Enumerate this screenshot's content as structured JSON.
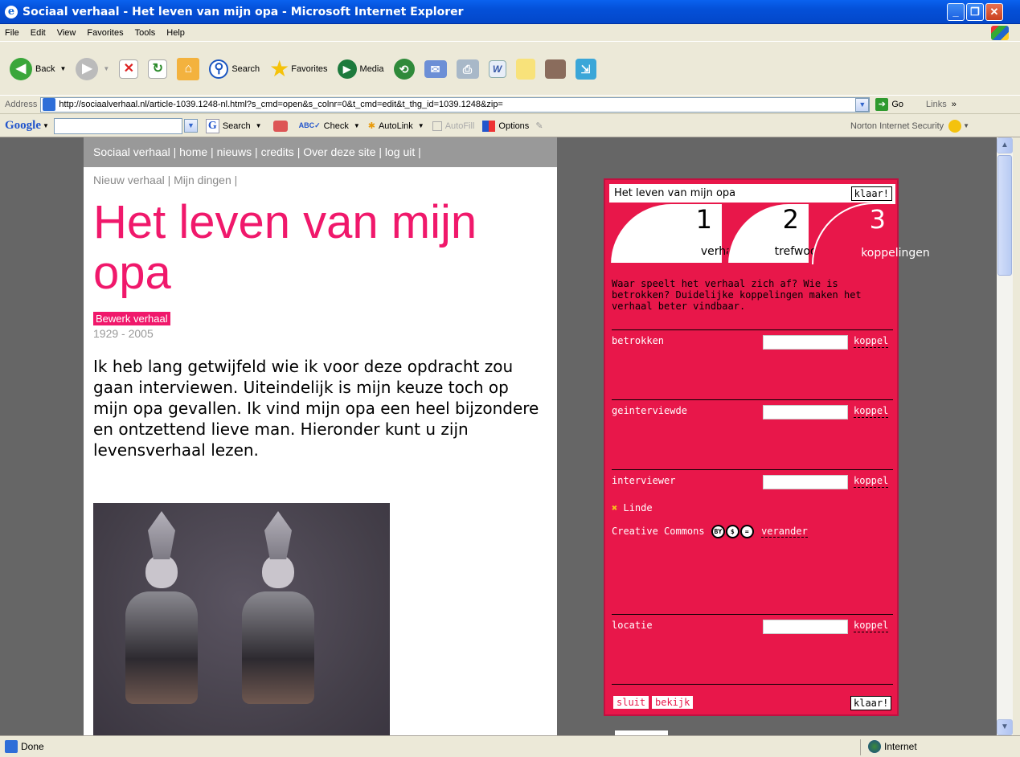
{
  "window": {
    "title": "Sociaal verhaal - Het leven van mijn opa - Microsoft Internet Explorer",
    "minimize": "_",
    "maximize": "❐",
    "close": "✕"
  },
  "menu": {
    "items": [
      "File",
      "Edit",
      "View",
      "Favorites",
      "Tools",
      "Help"
    ]
  },
  "toolbar": {
    "back": "Back",
    "search": "Search",
    "favorites": "Favorites",
    "media": "Media"
  },
  "address": {
    "label": "Address",
    "url": "http://sociaalverhaal.nl/article-1039.1248-nl.html?s_cmd=open&s_colnr=0&t_cmd=edit&t_thg_id=1039.1248&zip=",
    "go": "Go",
    "links": "Links"
  },
  "googlebar": {
    "logo": "Google",
    "search": "Search",
    "check": "Check",
    "autolink": "AutoLink",
    "autofill": "AutoFill",
    "options": "Options",
    "norton": "Norton Internet Security"
  },
  "site": {
    "nav": "Sociaal verhaal | home | nieuws | credits | Over deze site | log uit |",
    "subnav": "Nieuw verhaal | Mijn dingen |",
    "headline": "Het leven van mijn opa",
    "edit": "Bewerk verhaal",
    "years": "1929 - 2005",
    "intro": "Ik heb lang getwijfeld wie ik voor deze opdracht zou gaan interviewen. Uiteindelijk is mijn keuze toch op mijn opa gevallen. Ik vind mijn opa een heel bijzondere en ontzettend lieve man. Hieronder kunt u zijn levensverhaal lezen."
  },
  "panel": {
    "title": "Het leven van mijn opa",
    "klaar": "klaar!",
    "tabs": [
      {
        "num": "1",
        "label": "verhaal"
      },
      {
        "num": "2",
        "label": "trefwoorden"
      },
      {
        "num": "3",
        "label": "koppelingen"
      }
    ],
    "help": "Waar speelt het verhaal zich af? Wie is betrokken? Duidelijke koppelingen maken het verhaal beter vindbaar.",
    "sections": [
      {
        "label": "betrokken",
        "action": "koppel"
      },
      {
        "label": "geinterviewde",
        "action": "koppel"
      },
      {
        "label": "interviewer",
        "action": "koppel"
      },
      {
        "label": "locatie",
        "action": "koppel"
      }
    ],
    "interviewer_name": "Linde",
    "cc_label": "Creative Commons",
    "cc_change": "verander",
    "sluit": "sluit",
    "bekijk": "bekijk"
  },
  "status": {
    "left": "Done",
    "zone": "Internet"
  },
  "colors": {
    "accent": "#e8174a",
    "headline": "#f0186b",
    "nav": "#999999",
    "bg": "#666666"
  }
}
